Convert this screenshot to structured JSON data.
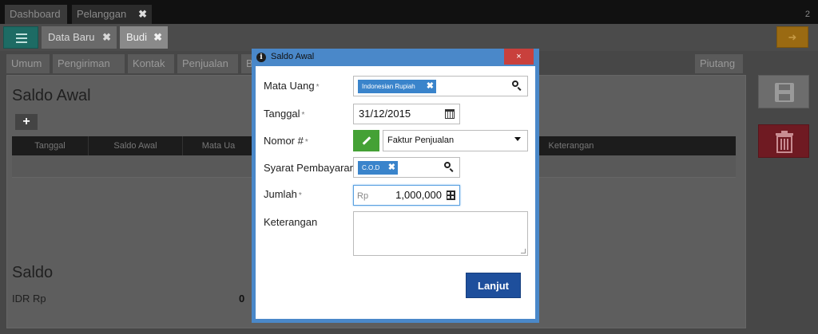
{
  "top_tabs": {
    "dashboard": "Dashboard",
    "pelanggan": "Pelanggan",
    "close": "✖",
    "count": "2"
  },
  "sub_tabs": {
    "data_baru": "Data Baru",
    "budi": "Budi",
    "close": "✖"
  },
  "inner_tabs": [
    "Umum",
    "Pengiriman",
    "Kontak",
    "Penjualan",
    "B",
    "Piutang"
  ],
  "panel": {
    "title": "Saldo Awal",
    "add_label": "+",
    "columns": [
      "Tanggal",
      "Saldo Awal",
      "Mata Ua",
      "Keterangan"
    ],
    "saldo_title": "Saldo",
    "idr_label": "IDR Rp",
    "idr_value": "0"
  },
  "modal": {
    "title": "Saldo Awal",
    "info_glyph": "i",
    "close": "×",
    "fields": {
      "mata_uang_label": "Mata Uang",
      "mata_uang_value": "Indonesian Rupiah",
      "tanggal_label": "Tanggal",
      "tanggal_value": "31/12/2015",
      "nomor_label": "Nomor #",
      "nomor_value": "Faktur Penjualan",
      "syarat_label": "Syarat Pembayaran",
      "syarat_value": "C.O.D",
      "jumlah_label": "Jumlah",
      "jumlah_prefix": "Rp",
      "jumlah_value": "1,000,000",
      "keterangan_label": "Keterangan",
      "keterangan_value": ""
    },
    "required_mark": "*",
    "chip_remove": "✖",
    "submit_label": "Lanjut"
  },
  "colors": {
    "accent": "#4a88c9",
    "submit": "#1e4f9c",
    "close": "#c9403c",
    "pencil": "#44a135",
    "delete": "#6f1a22",
    "chip": "#3a84cb"
  },
  "icons": [
    "menu-icon",
    "arrow-icon",
    "save-icon",
    "trash-icon",
    "info-icon",
    "search-icon",
    "calendar-icon",
    "pencil-icon",
    "calculator-icon"
  ]
}
